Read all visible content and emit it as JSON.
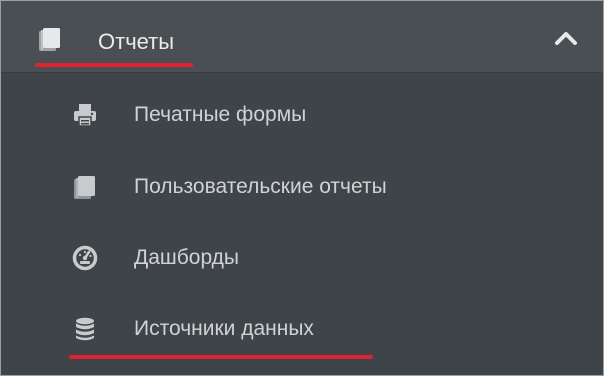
{
  "menu": {
    "header": {
      "label": "Отчеты",
      "icon": "book-icon",
      "expanded": true,
      "toggle_icon": "chevron-up-icon"
    },
    "items": [
      {
        "label": "Печатные формы",
        "icon": "printer-icon"
      },
      {
        "label": "Пользовательские отчеты",
        "icon": "book-icon"
      },
      {
        "label": "Дашборды",
        "icon": "dashboard-gauge-icon"
      },
      {
        "label": "Источники данных",
        "icon": "database-icon"
      }
    ]
  },
  "colors": {
    "menu_background": "#3f4448",
    "header_background": "#4a4f53",
    "text": "#d0d3d5",
    "icon": "#c8cbcd",
    "annotation_underline": "#e0232e"
  }
}
